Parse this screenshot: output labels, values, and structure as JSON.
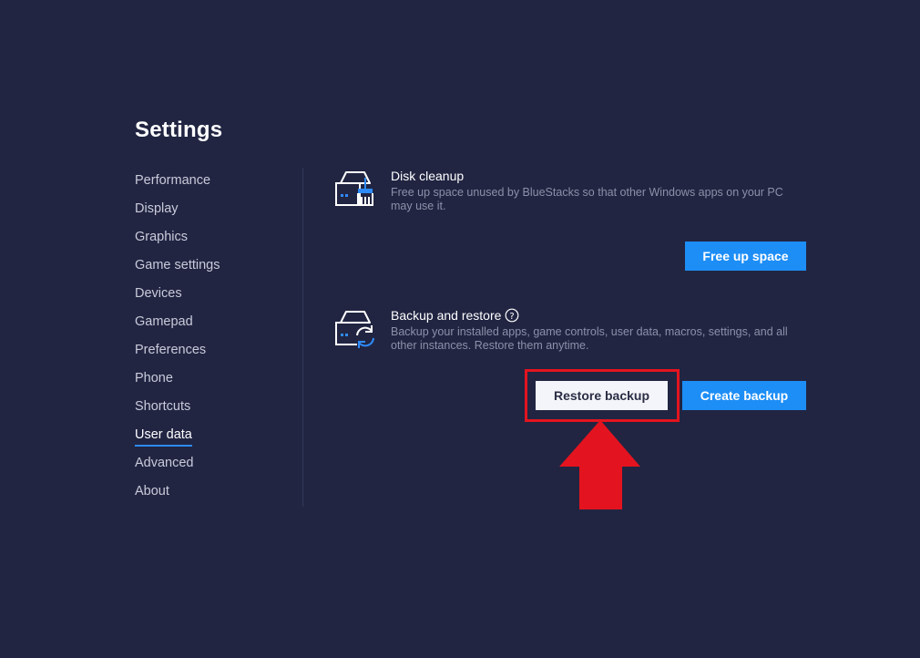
{
  "page": {
    "title": "Settings"
  },
  "sidebar": {
    "items": [
      {
        "label": "Performance",
        "active": false
      },
      {
        "label": "Display",
        "active": false
      },
      {
        "label": "Graphics",
        "active": false
      },
      {
        "label": "Game settings",
        "active": false
      },
      {
        "label": "Devices",
        "active": false
      },
      {
        "label": "Gamepad",
        "active": false
      },
      {
        "label": "Preferences",
        "active": false
      },
      {
        "label": "Phone",
        "active": false
      },
      {
        "label": "Shortcuts",
        "active": false
      },
      {
        "label": "User data",
        "active": true
      },
      {
        "label": "Advanced",
        "active": false
      },
      {
        "label": "About",
        "active": false
      }
    ]
  },
  "disk_cleanup": {
    "icon": "disk-cleanup-icon",
    "title": "Disk cleanup",
    "description": "Free up space unused by BlueStacks so that other Windows apps on your PC may use it.",
    "button_label": "Free up space"
  },
  "backup_restore": {
    "icon": "backup-restore-icon",
    "title": "Backup and restore",
    "help_icon": "help-icon",
    "description": "Backup your installed apps, game controls, user data, macros, settings, and all other instances. Restore them anytime.",
    "restore_label": "Restore backup",
    "create_label": "Create backup"
  },
  "annotation": {
    "highlight_color": "#e3141f",
    "arrow_direction": "up"
  },
  "colors": {
    "background": "#212542",
    "accent": "#1d8ef6",
    "text_muted": "#8c90a8"
  }
}
